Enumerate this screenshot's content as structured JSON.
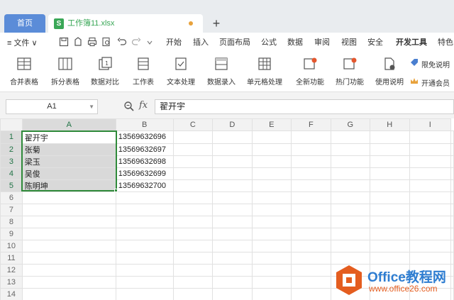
{
  "tabs": {
    "home_label": "首页",
    "file_icon_letter": "S",
    "file_name": "工作簿11.xlsx",
    "new_tab_symbol": "+"
  },
  "menu": {
    "file_label": "≡ 文件 ∨",
    "items": [
      "开始",
      "插入",
      "页面布局",
      "公式",
      "数据",
      "审阅",
      "视图",
      "安全",
      "开发工具",
      "特色"
    ]
  },
  "ribbon": {
    "buttons": [
      "合并表格",
      "拆分表格",
      "数据对比",
      "工作表",
      "文本处理",
      "数据录入",
      "单元格处理",
      "全新功能",
      "热门功能",
      "使用说明"
    ],
    "side_top": "限免说明",
    "side_bottom": "开通会员"
  },
  "formula_bar": {
    "name_box": "A1",
    "fx_label": "fx",
    "content": "翟开宇"
  },
  "grid": {
    "columns": [
      "A",
      "B",
      "C",
      "D",
      "E",
      "F",
      "G",
      "H",
      "I"
    ],
    "rows": [
      "1",
      "2",
      "3",
      "4",
      "5",
      "6",
      "7",
      "8",
      "9",
      "10",
      "11",
      "12",
      "13",
      "14"
    ],
    "data": [
      [
        "翟开宇",
        "13569632696"
      ],
      [
        "张菊",
        "13569632697"
      ],
      [
        "梁玉",
        "13569632698"
      ],
      [
        "吴俊",
        "13569632699"
      ],
      [
        "陈明坤",
        "13569632700"
      ]
    ]
  },
  "watermark": {
    "title": "Office教程网",
    "url": "www.office26.com"
  },
  "colors": {
    "home_tab": "#5b8cd8",
    "selection": "#2f8a3a",
    "watermark_orange": "#e45d1f",
    "watermark_blue": "#2e7dd1"
  }
}
